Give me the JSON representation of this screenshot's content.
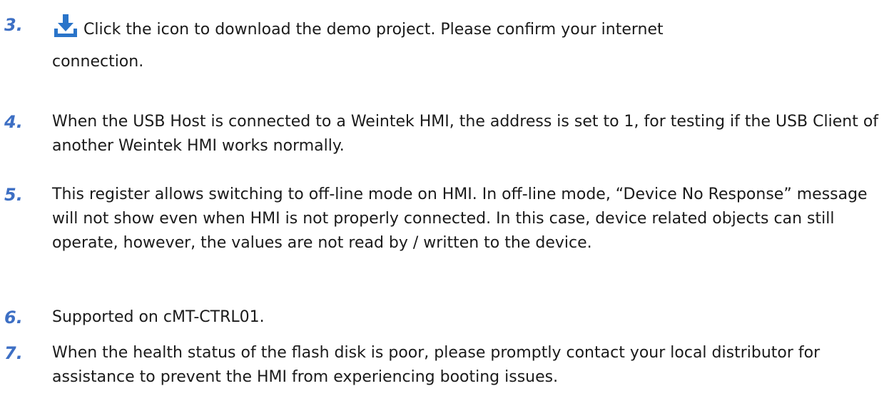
{
  "notes": [
    {
      "number": "3.",
      "icon": "download-icon",
      "text_line1": "Click the icon to download the demo project. Please confirm your internet",
      "text_line2": "connection."
    },
    {
      "number": "4.",
      "text": "When the USB Host is connected to a Weintek HMI, the address is set to 1, for testing if the USB Client of another Weintek HMI works normally."
    },
    {
      "number": "5.",
      "text": "This register allows switching to off-line mode on HMI. In off-line mode, “Device No Response” message will not show even when HMI is not properly connected. In this case, device related objects can still operate, however, the values are not read by / written to the device."
    },
    {
      "number": "6.",
      "text": "Supported on cMT-CTRL01."
    },
    {
      "number": "7.",
      "text": "When the health status of the flash disk is poor, please promptly contact your local distributor for assistance to prevent the HMI from experiencing booting issues."
    }
  ],
  "colors": {
    "number": "#3d6fc4",
    "icon_blue": "#2a74c9",
    "text": "#1a1a1a"
  }
}
